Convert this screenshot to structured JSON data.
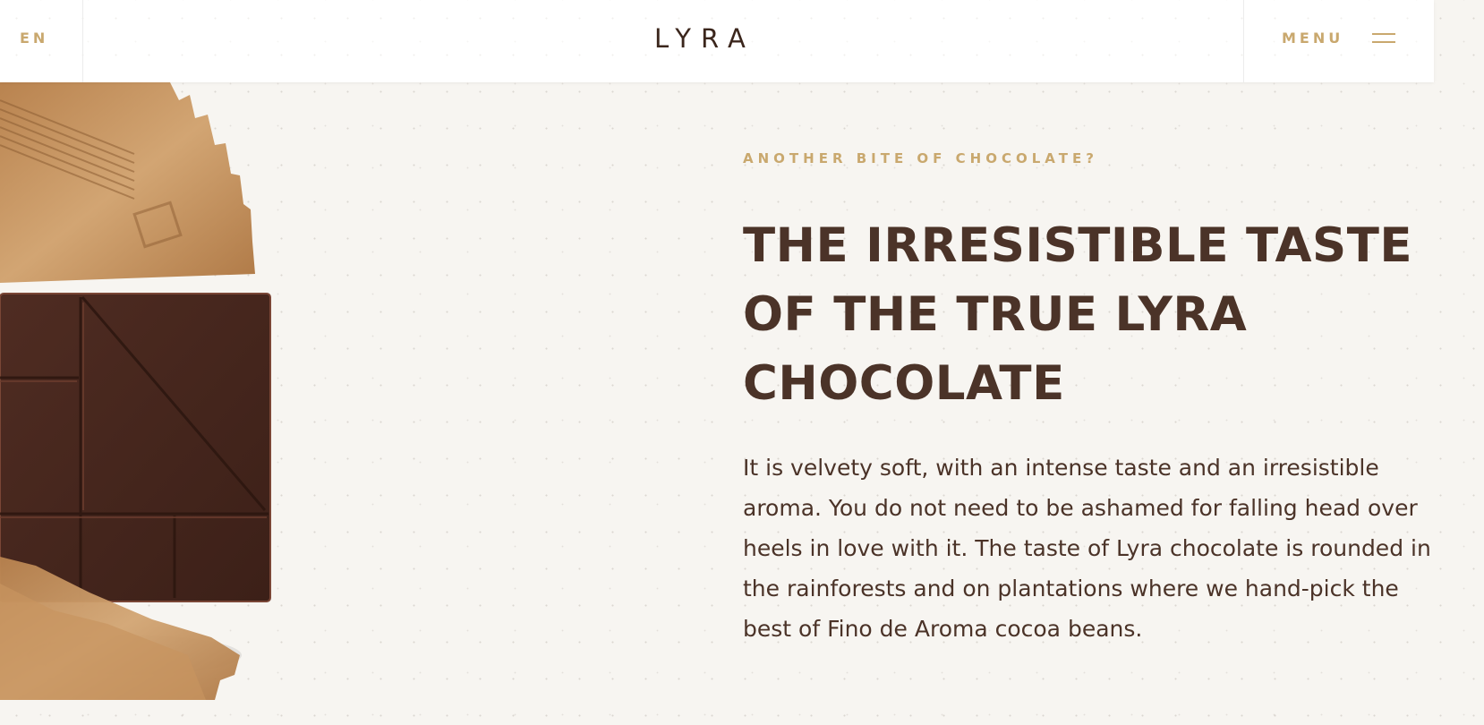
{
  "header": {
    "language": "EN",
    "logo": "LYRA",
    "menu_label": "MENU"
  },
  "hero": {
    "eyebrow": "ANOTHER BITE OF CHOCOLATE?",
    "headline": "THE IRRESISTIBLE TASTE OF THE TRUE LYRA CHOCOLATE",
    "body": "It is velvety soft, with an intense taste and an irresistible aroma. You do not need to be ashamed for falling head over heels in love with it. The taste of Lyra chocolate is rounded in the rainforests and on plantations where we hand-pick the best of Fino de Aroma cocoa beans."
  },
  "colors": {
    "background": "#f7f5f1",
    "accent_gold": "#c9a86e",
    "text_brown": "#4b3328",
    "logo_brown": "#3b261c",
    "chocolate": "#4a2a20",
    "wrapper_kraft": "#c08f5c"
  },
  "icons": {
    "menu": "hamburger-icon"
  }
}
